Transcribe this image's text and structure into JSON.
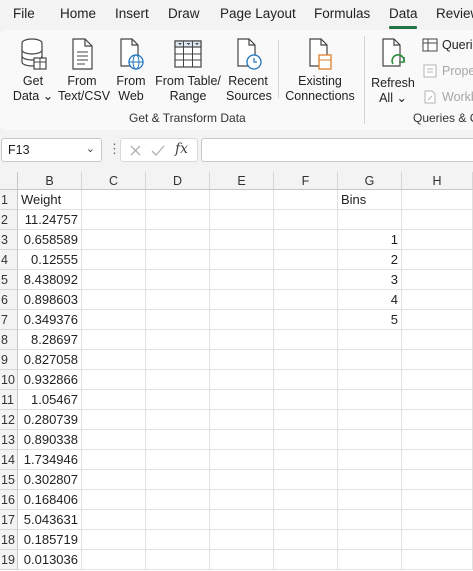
{
  "menu": {
    "tabs": [
      "File",
      "Home",
      "Insert",
      "Draw",
      "Page Layout",
      "Formulas",
      "Data",
      "Review"
    ],
    "active": "Data"
  },
  "ribbon": {
    "get_transform": {
      "get_data": [
        "Get",
        "Data ⌄"
      ],
      "from_text_csv": [
        "From",
        "Text/CSV"
      ],
      "from_web": [
        "From",
        "Web"
      ],
      "from_table_range": [
        "From Table/",
        "Range"
      ],
      "recent_sources": [
        "Recent",
        "Sources"
      ],
      "existing_connections": [
        "Existing",
        "Connections"
      ],
      "group_label": "Get & Transform Data"
    },
    "queries": {
      "refresh_all": [
        "Refresh",
        "All ⌄"
      ],
      "queries_connections": "Queri",
      "properties": "Prope",
      "workbook_links": "Workb",
      "group_label": "Queries & C"
    }
  },
  "formula_bar": {
    "name_box": "F13",
    "fx": "fx",
    "formula": ""
  },
  "sheet": {
    "columns": [
      "B",
      "C",
      "D",
      "E",
      "F",
      "G",
      "H"
    ],
    "rows": [
      "1",
      "2",
      "3",
      "4",
      "5",
      "6",
      "7",
      "8",
      "9",
      "10",
      "11",
      "12",
      "13",
      "14",
      "15",
      "16",
      "17",
      "18",
      "19"
    ],
    "col_B": [
      "Weight",
      "11.24757",
      "0.658589",
      "0.12555",
      "8.438092",
      "0.898603",
      "0.349376",
      "8.28697",
      "0.827058",
      "0.932866",
      "1.05467",
      "0.280739",
      "0.890338",
      "1.734946",
      "0.302807",
      "0.168406",
      "5.043631",
      "0.185719",
      "0.013036"
    ],
    "col_G": [
      "Bins",
      "",
      "1",
      "2",
      "3",
      "4",
      "5",
      "",
      "",
      "",
      "",
      "",
      "",
      "",
      "",
      "",
      "",
      "",
      ""
    ]
  },
  "colors": {
    "accent": "#217346",
    "grid_line": "#e1e1e1",
    "header_bg": "#f3f3f3"
  }
}
